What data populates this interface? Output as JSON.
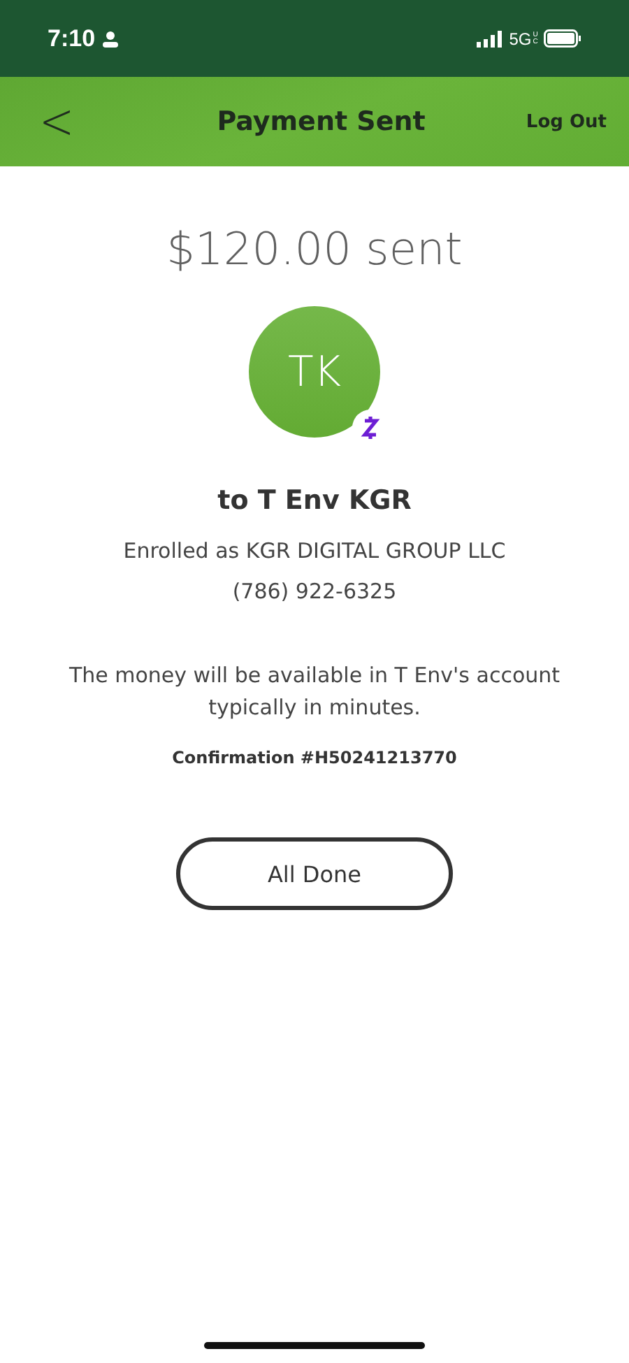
{
  "status_bar": {
    "time": "7:10",
    "network": "5G",
    "network_sub": "UC"
  },
  "header": {
    "back": "<",
    "title": "Payment Sent",
    "action": "Log Out"
  },
  "amount": "$120.00 sent",
  "recipient": {
    "initials": "TK",
    "name": "to T Env KGR",
    "enrolled": "Enrolled as KGR DIGITAL GROUP LLC",
    "phone": "(786) 922-6325"
  },
  "message": "The money will be available in T Env's account typically in minutes.",
  "confirmation": "Confirmation #H50241213770",
  "button": "All Done"
}
